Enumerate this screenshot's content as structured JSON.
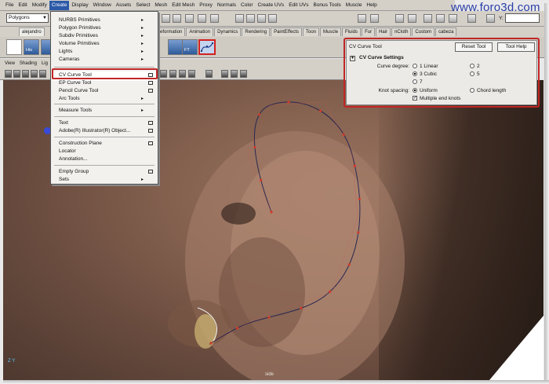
{
  "watermark": "www.foro3d.com",
  "menubar": {
    "items": [
      "File",
      "Edit",
      "Modify",
      "Create",
      "Display",
      "Window",
      "Assets",
      "Select",
      "Mesh",
      "Edit Mesh",
      "Proxy",
      "Normals",
      "Color",
      "Create UVs",
      "Edit UVs",
      "Bonus Tools",
      "Muscle",
      "Help"
    ],
    "active": "Create"
  },
  "status_line": {
    "mode": "Polygons",
    "y_label": "Y:"
  },
  "shelf": {
    "tabs": [
      "alejandro",
      "Deformation",
      "Animation",
      "Dynamics",
      "Rendering",
      "PaintEffects",
      "Toon",
      "Muscle",
      "Fluids",
      "Fur",
      "Hair",
      "nCloth",
      "Custom",
      "cabeza"
    ],
    "icon_labels": [
      "His",
      "FT"
    ]
  },
  "panel_menu": [
    "View",
    "Shading",
    "Lig"
  ],
  "create_menu": {
    "items": [
      {
        "label": "NURBS Primitives",
        "submenu": true
      },
      {
        "label": "Polygon Primitives",
        "submenu": true
      },
      {
        "label": "Subdiv Primitives",
        "submenu": true
      },
      {
        "label": "Volume Primitives",
        "submenu": true
      },
      {
        "label": "Lights",
        "submenu": true
      },
      {
        "label": "Cameras",
        "submenu": true
      },
      {
        "label": "CV Curve Tool",
        "option": true,
        "highlighted": true
      },
      {
        "label": "EP Curve Tool",
        "option": true
      },
      {
        "label": "Pencil Curve Tool",
        "option": true
      },
      {
        "label": "Arc Tools",
        "submenu": true
      },
      {
        "label": "Measure Tools",
        "submenu": true
      },
      {
        "label": "Text",
        "option": true
      },
      {
        "label": "Adobe(R) Illustrator(R) Object...",
        "option": true
      },
      {
        "label": "Construction Plane",
        "option": true
      },
      {
        "label": "Locator"
      },
      {
        "label": "Annotation..."
      },
      {
        "label": "Empty Group",
        "option": true
      },
      {
        "label": "Sets",
        "submenu": true
      }
    ]
  },
  "tool_settings": {
    "title": "CV Curve Tool",
    "reset_label": "Reset Tool",
    "help_label": "Tool Help",
    "section": "CV Curve Settings",
    "curve_degree_label": "Curve degree:",
    "degree_options": [
      "1 Linear",
      "2",
      "3 Cubic",
      "5",
      "7"
    ],
    "degree_selected": "3 Cubic",
    "knot_spacing_label": "Knot spacing:",
    "knot_options": [
      "Uniform",
      "Chord length"
    ],
    "knot_selected": "Uniform",
    "multiple_end_knots_label": "Multiple end knots",
    "multiple_end_knots": true
  },
  "viewport": {
    "camera_label": "side",
    "axis_label": "Z Y"
  },
  "colors": {
    "highlight_outline": "#c12626",
    "menu_active": "#2c5aa8",
    "curve": "#2a2850",
    "cv_point": "#d23a2a"
  }
}
